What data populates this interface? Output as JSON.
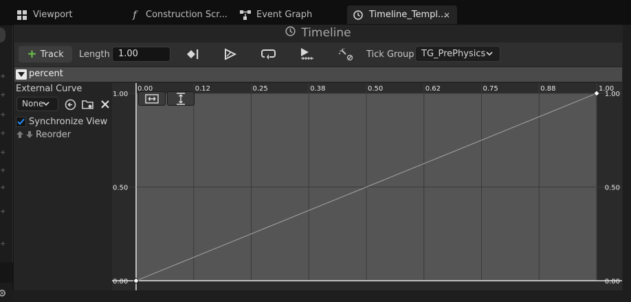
{
  "tabs": [
    {
      "label": "Viewport",
      "icon": "grid-icon"
    },
    {
      "label": "Construction Scr...",
      "icon": "function-icon"
    },
    {
      "label": "Event Graph",
      "icon": "graph-icon"
    },
    {
      "label": "Timeline_Templ...",
      "icon": "clock-icon",
      "active": true,
      "close": "×"
    }
  ],
  "title": "Timeline",
  "toolbar": {
    "track_label": "Track",
    "length_label": "Length",
    "length_value": "1.00",
    "tick_group_label": "Tick Group",
    "tick_group_value": "TG_PrePhysics"
  },
  "track": {
    "name": "percent",
    "external_curve_label": "External Curve",
    "external_curve_value": "None",
    "synchronize_view_label": "Synchronize View",
    "synchronize_view_checked": true,
    "reorder_label": "Reorder"
  },
  "graph": {
    "time_ticks": [
      "0.00",
      "0.12",
      "0.25",
      "0.38",
      "0.50",
      "0.62",
      "0.75",
      "0.88",
      "1.00"
    ],
    "value_ticks_left": [
      "1.00",
      "0.50",
      "0.00"
    ],
    "value_ticks_right": [
      "1.00",
      "0.50",
      "0.00"
    ],
    "keys": [
      {
        "time": 0.0,
        "value": 0.0
      },
      {
        "time": 1.0,
        "value": 1.0
      }
    ]
  },
  "colors": {
    "accent_green": "#6bc24a",
    "check_blue": "#1e90ff"
  }
}
